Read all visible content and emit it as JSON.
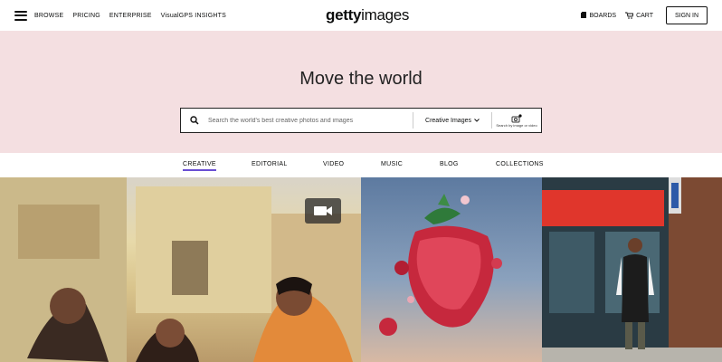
{
  "header": {
    "nav": [
      "BROWSE",
      "PRICING",
      "ENTERPRISE",
      "VisualGPS INSIGHTS"
    ],
    "logo_bold": "getty",
    "logo_light": "images",
    "boards_label": "BOARDS",
    "cart_label": "CART",
    "signin_label": "SIGN IN"
  },
  "hero": {
    "headline": "Move the world",
    "search_placeholder": "Search the world's best creative photos and images",
    "content_type": "Creative Images",
    "search_by_image_label": "Search by image or video"
  },
  "tabs": [
    {
      "label": "CREATIVE",
      "active": true
    },
    {
      "label": "EDITORIAL",
      "active": false
    },
    {
      "label": "VIDEO",
      "active": false
    },
    {
      "label": "MUSIC",
      "active": false
    },
    {
      "label": "BLOG",
      "active": false
    },
    {
      "label": "COLLECTIONS",
      "active": false
    }
  ],
  "colors": {
    "hero_bg": "#f4dfe1",
    "tab_underline": "#6a4fd3"
  }
}
